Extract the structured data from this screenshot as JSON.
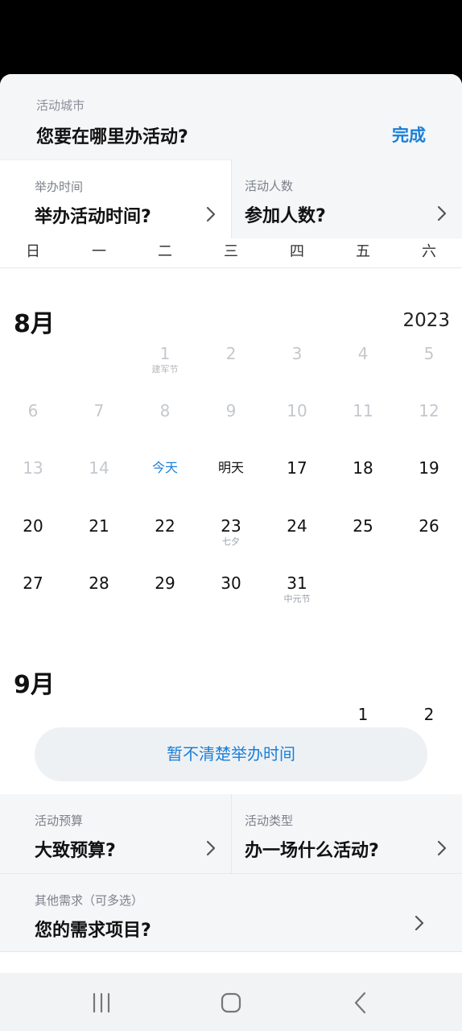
{
  "city": {
    "label": "活动城市",
    "value": "您要在哪里办活动?",
    "done": "完成"
  },
  "time": {
    "label": "举办时间",
    "value": "举办活动时间?"
  },
  "people": {
    "label": "活动人数",
    "value": "参加人数?"
  },
  "weekdays": [
    "日",
    "一",
    "二",
    "三",
    "四",
    "五",
    "六"
  ],
  "calendar": {
    "august": {
      "month": "8月",
      "year": "2023",
      "days": [
        {
          "num": "1",
          "sub": "建军节"
        },
        {
          "num": "2"
        },
        {
          "num": "3"
        },
        {
          "num": "4"
        },
        {
          "num": "5"
        },
        {
          "num": "6"
        },
        {
          "num": "7"
        },
        {
          "num": "8"
        },
        {
          "num": "9"
        },
        {
          "num": "10"
        },
        {
          "num": "11"
        },
        {
          "num": "12"
        },
        {
          "num": "13"
        },
        {
          "num": "14"
        },
        {
          "num": "今天"
        },
        {
          "num": "明天"
        },
        {
          "num": "17"
        },
        {
          "num": "18"
        },
        {
          "num": "19"
        },
        {
          "num": "20"
        },
        {
          "num": "21"
        },
        {
          "num": "22"
        },
        {
          "num": "23",
          "sub": "七夕"
        },
        {
          "num": "24"
        },
        {
          "num": "25"
        },
        {
          "num": "26"
        },
        {
          "num": "27"
        },
        {
          "num": "28"
        },
        {
          "num": "29"
        },
        {
          "num": "30"
        },
        {
          "num": "31",
          "sub": "中元节"
        }
      ]
    },
    "september": {
      "month": "9月",
      "days": [
        {
          "num": "1"
        },
        {
          "num": "2"
        }
      ]
    }
  },
  "unsure_button": "暂不清楚举办时间",
  "budget": {
    "label": "活动预算",
    "value": "大致预算?"
  },
  "type": {
    "label": "活动类型",
    "value": "办一场什么活动?"
  },
  "other": {
    "label": "其他需求（可多选）",
    "value": "您的需求项目?"
  },
  "colors": {
    "accent": "#1a7fd8",
    "muted": "#c4c8cd",
    "panel": "#f5f6f8"
  }
}
